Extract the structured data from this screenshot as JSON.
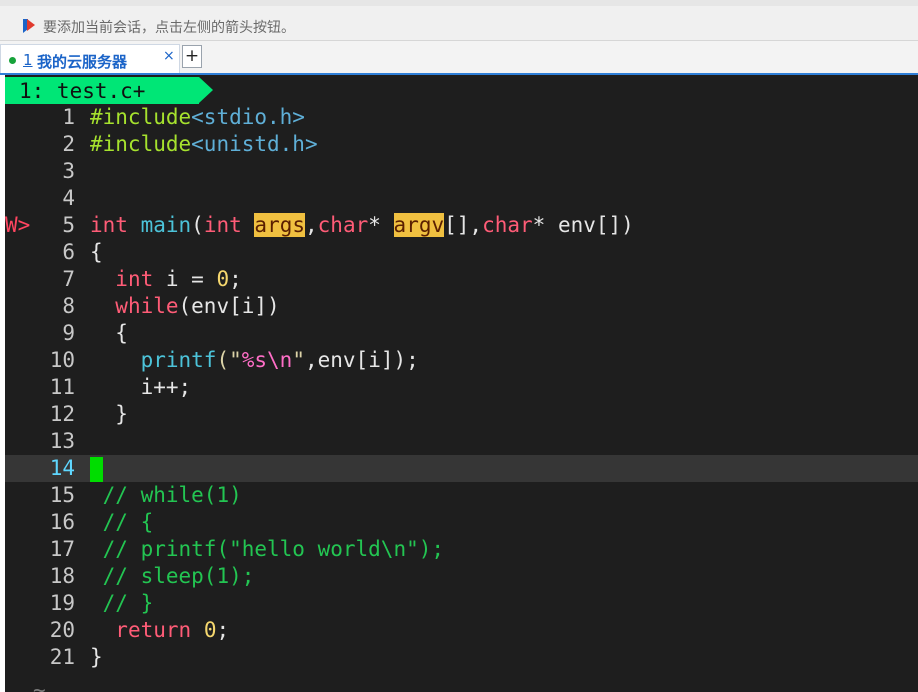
{
  "hint": {
    "text": "要添加当前会话，点击左侧的箭头按钮。",
    "icon": "bookmark-arrow-icon"
  },
  "session_tab": {
    "number": "1",
    "title": "我的云服务器",
    "close": "×",
    "add": "+"
  },
  "vim": {
    "tabline": "1: test.c+",
    "sign": "W>",
    "current_line": "14",
    "line_numbers": [
      "1",
      "2",
      "3",
      "4",
      "5",
      "6",
      "7",
      "8",
      "9",
      "10",
      "11",
      "12",
      "13",
      "14",
      "15",
      "16",
      "17",
      "18",
      "19",
      "20",
      "21"
    ],
    "code": {
      "l1": {
        "directive": "#include",
        "header": "<stdio.h>"
      },
      "l2": {
        "directive": "#include",
        "header": "<unistd.h>"
      },
      "l5": {
        "ret_type": "int",
        "name": "main",
        "p1_type": "int",
        "p1_name": "args",
        "p2_type": "char",
        "p2_ptr": "*",
        "p2_name": "argv",
        "p3_type": "char",
        "p3_ptr": "*",
        "p3_name": "env"
      },
      "l6": "{",
      "l7": {
        "type": "int",
        "rest": " i = ",
        "value": "0",
        "end": ";"
      },
      "l8": {
        "kw": "while",
        "rest": "(env[i])"
      },
      "l9": "{",
      "l10": {
        "fn": "printf",
        "open": "(\"",
        "fmt": "%s",
        "esc": "\\n",
        "close": "\"",
        "rest": ",env[i]);"
      },
      "l11": "i++;",
      "l12": "}",
      "l15": "// while(1)",
      "l16": "// {",
      "l17": "// printf(\"hello world\\n\");",
      "l18": "// sleep(1);",
      "l19": "// }",
      "l20": {
        "kw": "return",
        "value": "0",
        "end": ";"
      },
      "l21": "}"
    },
    "tilde": "~"
  },
  "colors": {
    "accent_tab": "#00e676",
    "terminal_bg": "#1e1e1e",
    "comment": "#23c552",
    "keyword": "#ff5c77",
    "highlight": "#f0c040",
    "cursor": "#00dd00"
  }
}
